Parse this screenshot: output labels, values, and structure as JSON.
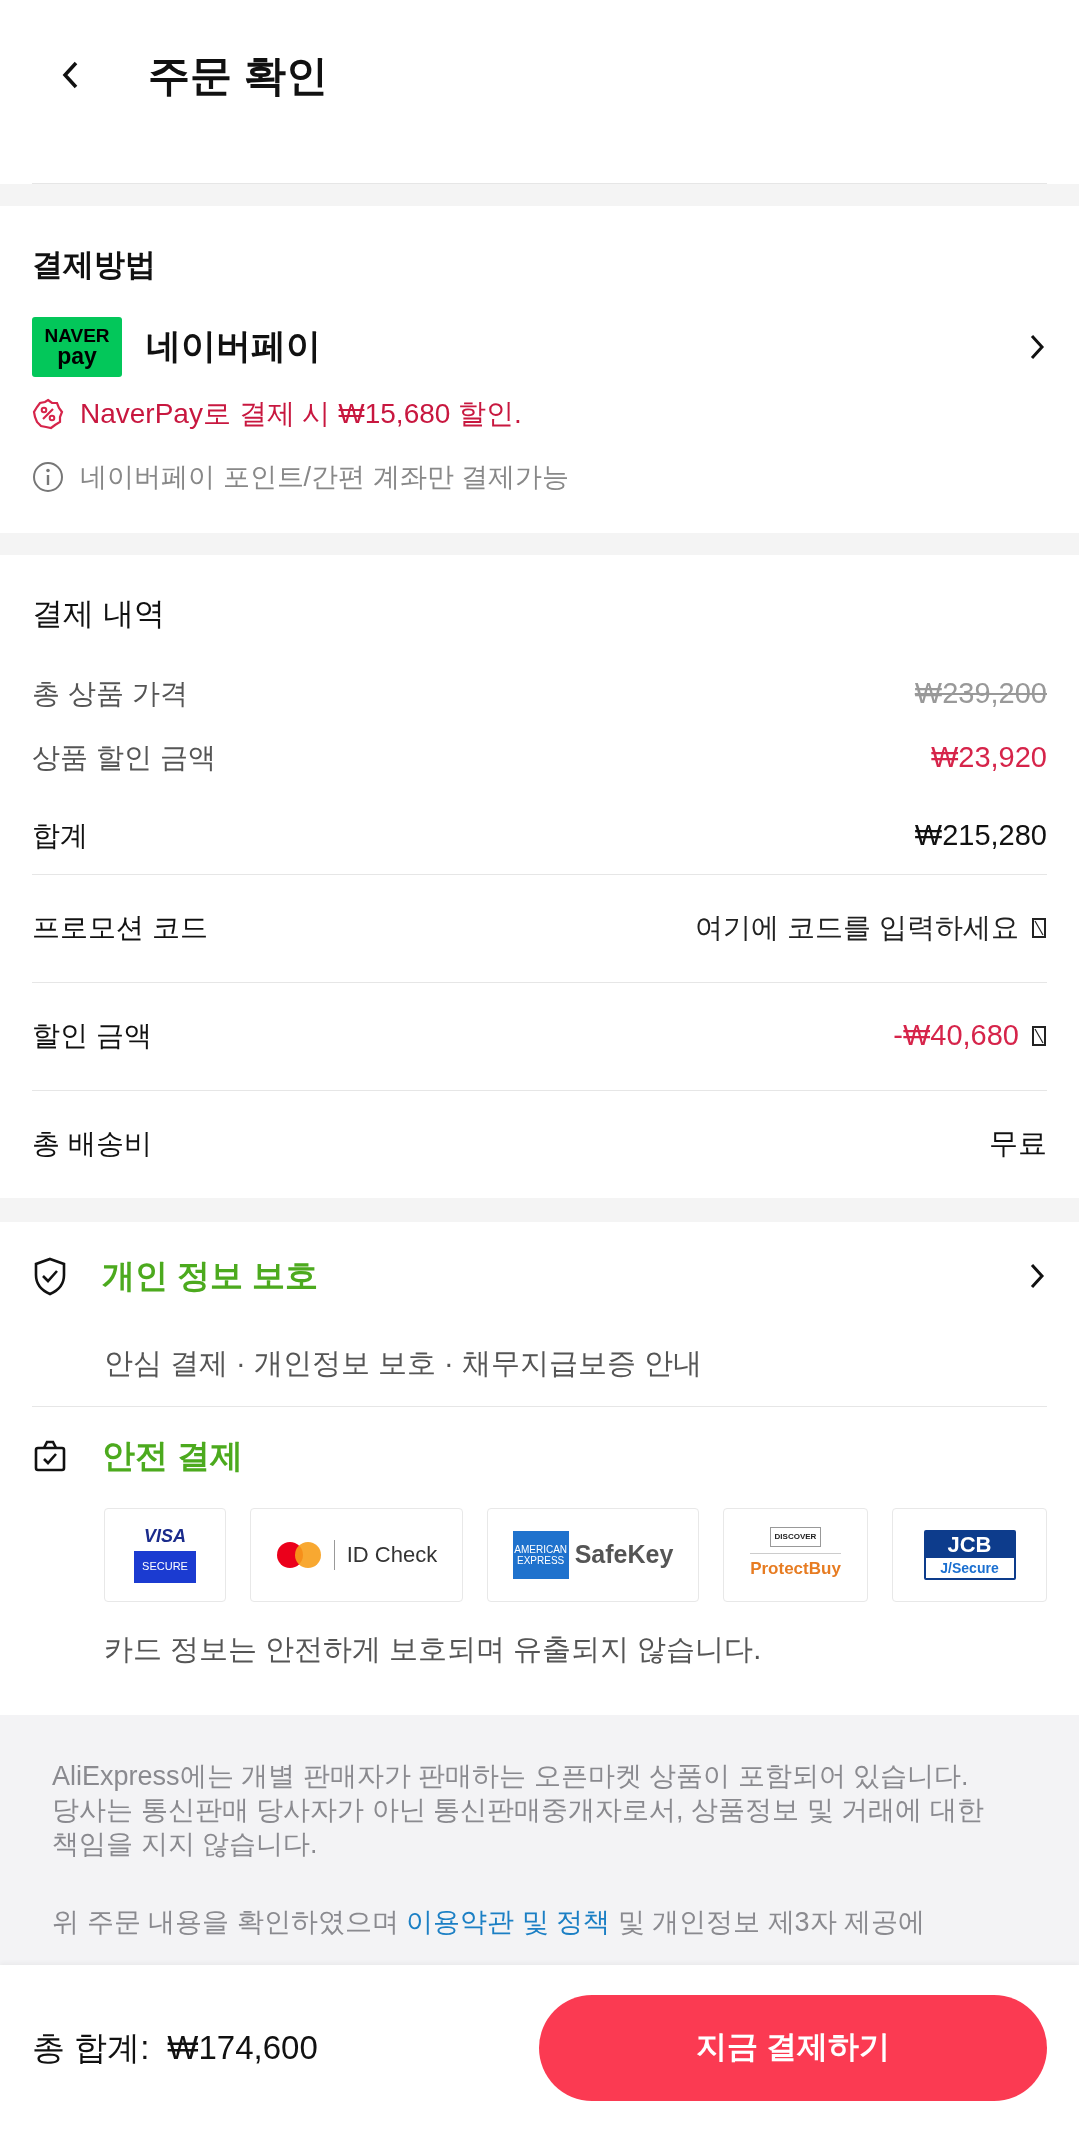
{
  "header": {
    "title": "주문 확인"
  },
  "payment_method": {
    "title": "결제방법",
    "logo": {
      "line1": "NAVER",
      "line2": "pay"
    },
    "name": "네이버페이",
    "promo": "NaverPay로 결제 시 ₩15,680 할인.",
    "note": "네이버페이 포인트/간편 계좌만 결제가능"
  },
  "payment_details": {
    "title": "결제 내역",
    "price_rows": [
      {
        "label": "총 상품 가격",
        "value": "₩239,200",
        "kind": "original"
      },
      {
        "label": "상품 할인 금액",
        "value": "₩23,920",
        "kind": "discount"
      },
      {
        "label": "합계",
        "value": "₩215,280",
        "kind": "plain"
      }
    ],
    "detail_rows": [
      {
        "label": "프로모션 코드",
        "value": "여기에 코드를 입력하세요",
        "kind": "input",
        "trailing_box": true
      },
      {
        "label": "할인 금액",
        "value": "-₩40,680",
        "kind": "discount",
        "trailing_box": true
      },
      {
        "label": "총 배송비",
        "value": "무료",
        "kind": "plain",
        "trailing_box": false
      }
    ]
  },
  "privacy": {
    "title": "개인 정보 보호",
    "subtitle": "안심 결제 · 개인정보 보호 · 채무지급보증 안내"
  },
  "secure_payment": {
    "title": "안전 결제",
    "cards": [
      {
        "kind": "visa",
        "texts": [
          "VISA",
          "SECURE"
        ]
      },
      {
        "kind": "mastercard",
        "texts": [
          "ID Check"
        ]
      },
      {
        "kind": "amex",
        "texts": [
          "AMERICAN EXPRESS",
          "SafeKey"
        ]
      },
      {
        "kind": "discover",
        "texts": [
          "DISCOVER",
          "ProtectBuy"
        ]
      },
      {
        "kind": "jcb",
        "texts": [
          "JCB",
          "J/Secure"
        ]
      }
    ],
    "note": "카드 정보는 안전하게 보호되며 유출되지 않습니다."
  },
  "disclaimer": [
    {
      "text": "AliExpress에는 개별 판매자가 판매하는 오픈마켓 상품이 포함되어 있습니다. 당사는 통신판매 당사자가 아닌 통신판매중개자로서, 상품정보 및 거래에 대한 책임을 지지 않습니다."
    },
    {
      "text": "위 주문 내용을 확인하였으며",
      "link": "이용약관 및 정책",
      "after": "및 개인정보 제3자 제공에"
    }
  ],
  "footer": {
    "total_label": "총 합계:",
    "total_value": "₩174,600",
    "button": "지금 결제하기"
  }
}
